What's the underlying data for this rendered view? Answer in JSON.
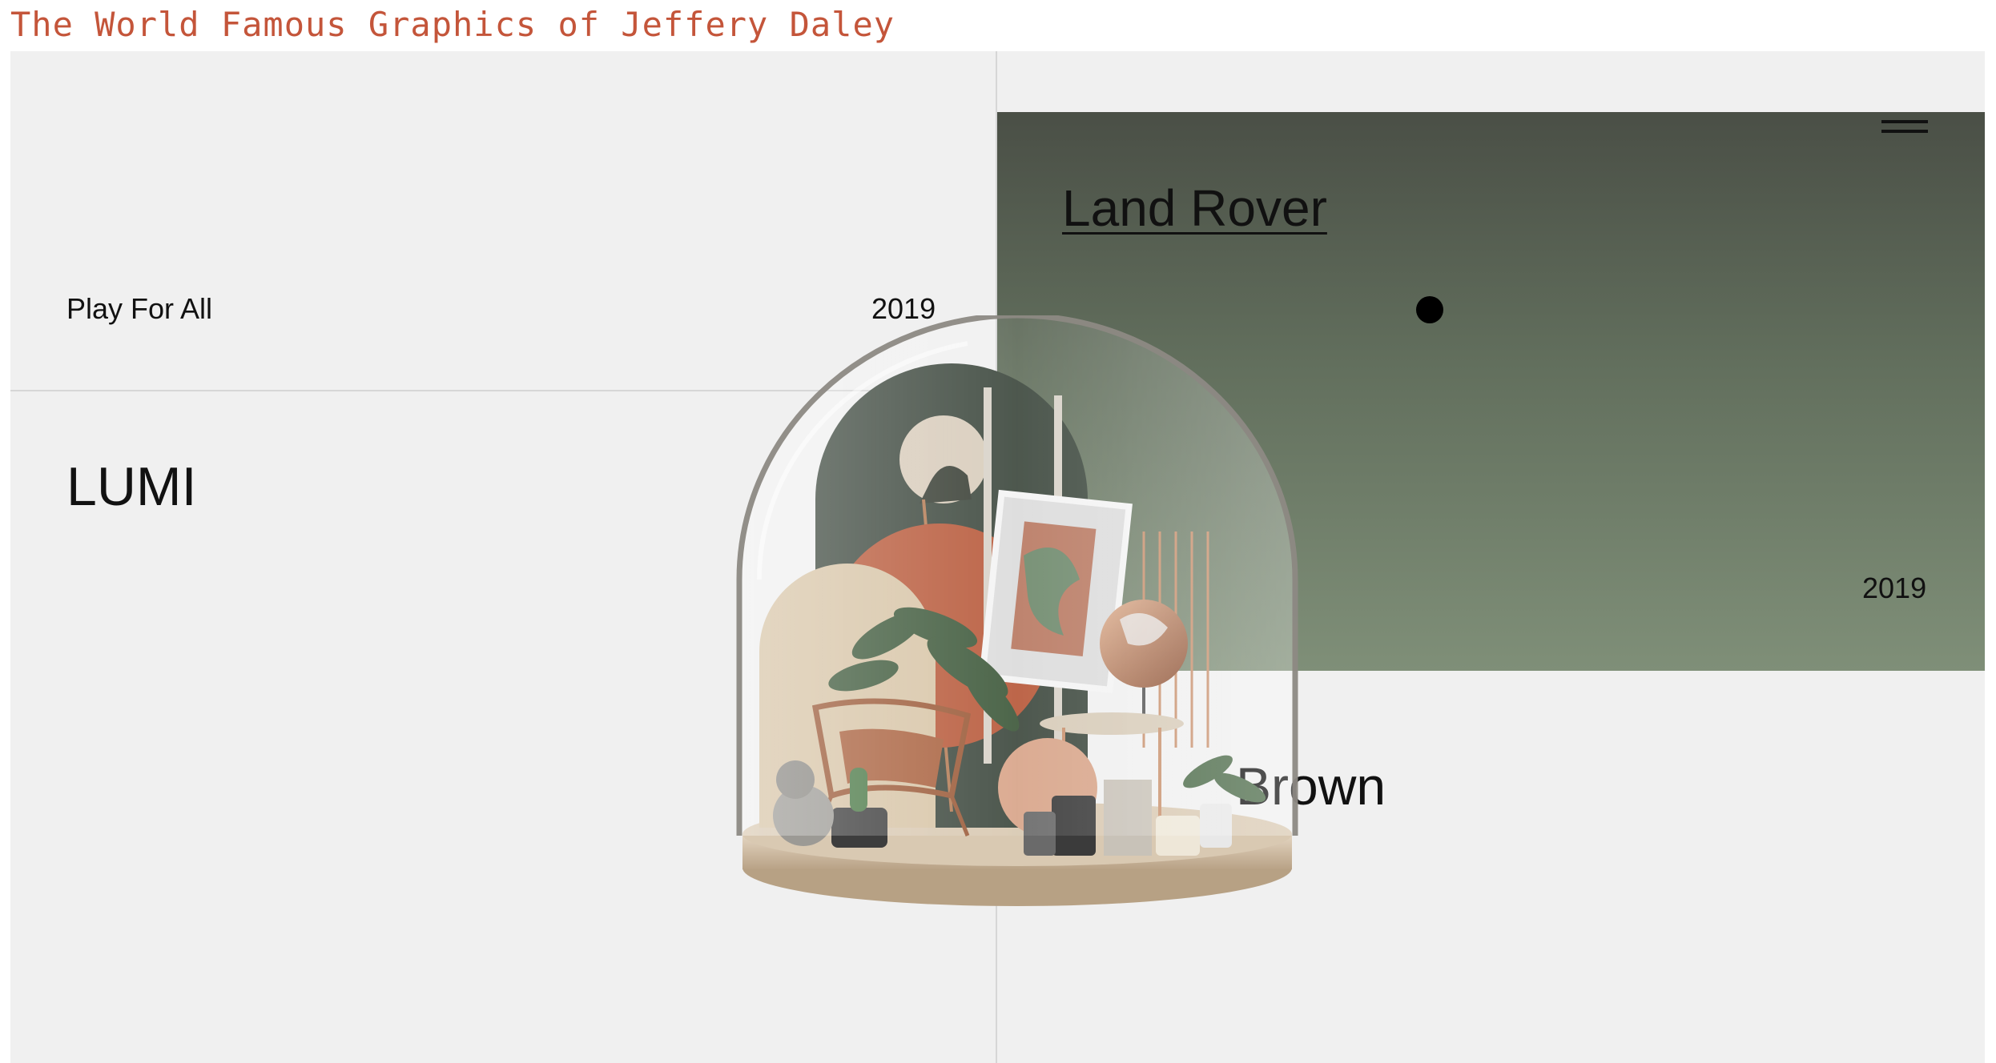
{
  "site": {
    "title": "The World Famous Graphics of Jeffery Daley"
  },
  "projects": {
    "play_for_all": {
      "label": "Play For All",
      "year": "2019"
    },
    "lumi": {
      "label": "LUMI"
    },
    "land_rover": {
      "label": "Land Rover",
      "year": "2019"
    },
    "brown": {
      "label": "Brown"
    }
  },
  "colors": {
    "title_accent": "#c4553a",
    "canvas_bg": "#f0f0f0",
    "panel_top": "#4a4f46",
    "panel_bottom": "#7f8f78",
    "text": "#111111"
  },
  "icons": {
    "menu": "hamburger-icon",
    "cursor": "dot-cursor-icon"
  }
}
